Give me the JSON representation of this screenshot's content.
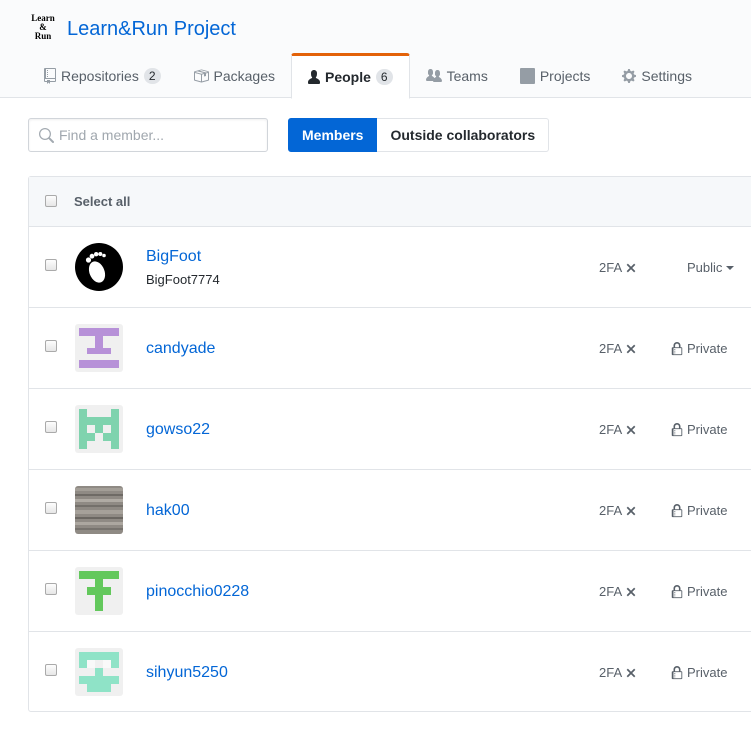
{
  "org": {
    "logo_lines": [
      "Learn",
      "&",
      "Run"
    ],
    "name": "Learn&Run Project"
  },
  "tabs": [
    {
      "label": "Repositories",
      "count": "2",
      "icon": "repo-icon"
    },
    {
      "label": "Packages",
      "icon": "package-icon"
    },
    {
      "label": "People",
      "count": "6",
      "icon": "person-icon",
      "selected": true
    },
    {
      "label": "Teams",
      "icon": "teams-icon"
    },
    {
      "label": "Projects",
      "icon": "project-icon"
    },
    {
      "label": "Settings",
      "icon": "gear-icon"
    }
  ],
  "search": {
    "placeholder": "Find a member...",
    "value": ""
  },
  "filter": {
    "members_label": "Members",
    "outside_label": "Outside collaborators"
  },
  "table": {
    "select_all_label": "Select all"
  },
  "members": [
    {
      "login": "BigFoot",
      "name": "BigFoot7774",
      "twofa": "2FA",
      "visibility": "Public",
      "avatar": "footprint"
    },
    {
      "login": "candyade",
      "twofa": "2FA",
      "visibility": "Private",
      "avatar": "identicon-purple"
    },
    {
      "login": "gowso22",
      "twofa": "2FA",
      "visibility": "Private",
      "avatar": "identicon-mint"
    },
    {
      "login": "hak00",
      "twofa": "2FA",
      "visibility": "Private",
      "avatar": "stone-photo"
    },
    {
      "login": "pinocchio0228",
      "twofa": "2FA",
      "visibility": "Private",
      "avatar": "identicon-green"
    },
    {
      "login": "sihyun5250",
      "twofa": "2FA",
      "visibility": "Private",
      "avatar": "identicon-aqua"
    }
  ],
  "colors": {
    "link": "#0366d6",
    "tab_accent": "#e36209",
    "button_primary": "#0366d6"
  }
}
